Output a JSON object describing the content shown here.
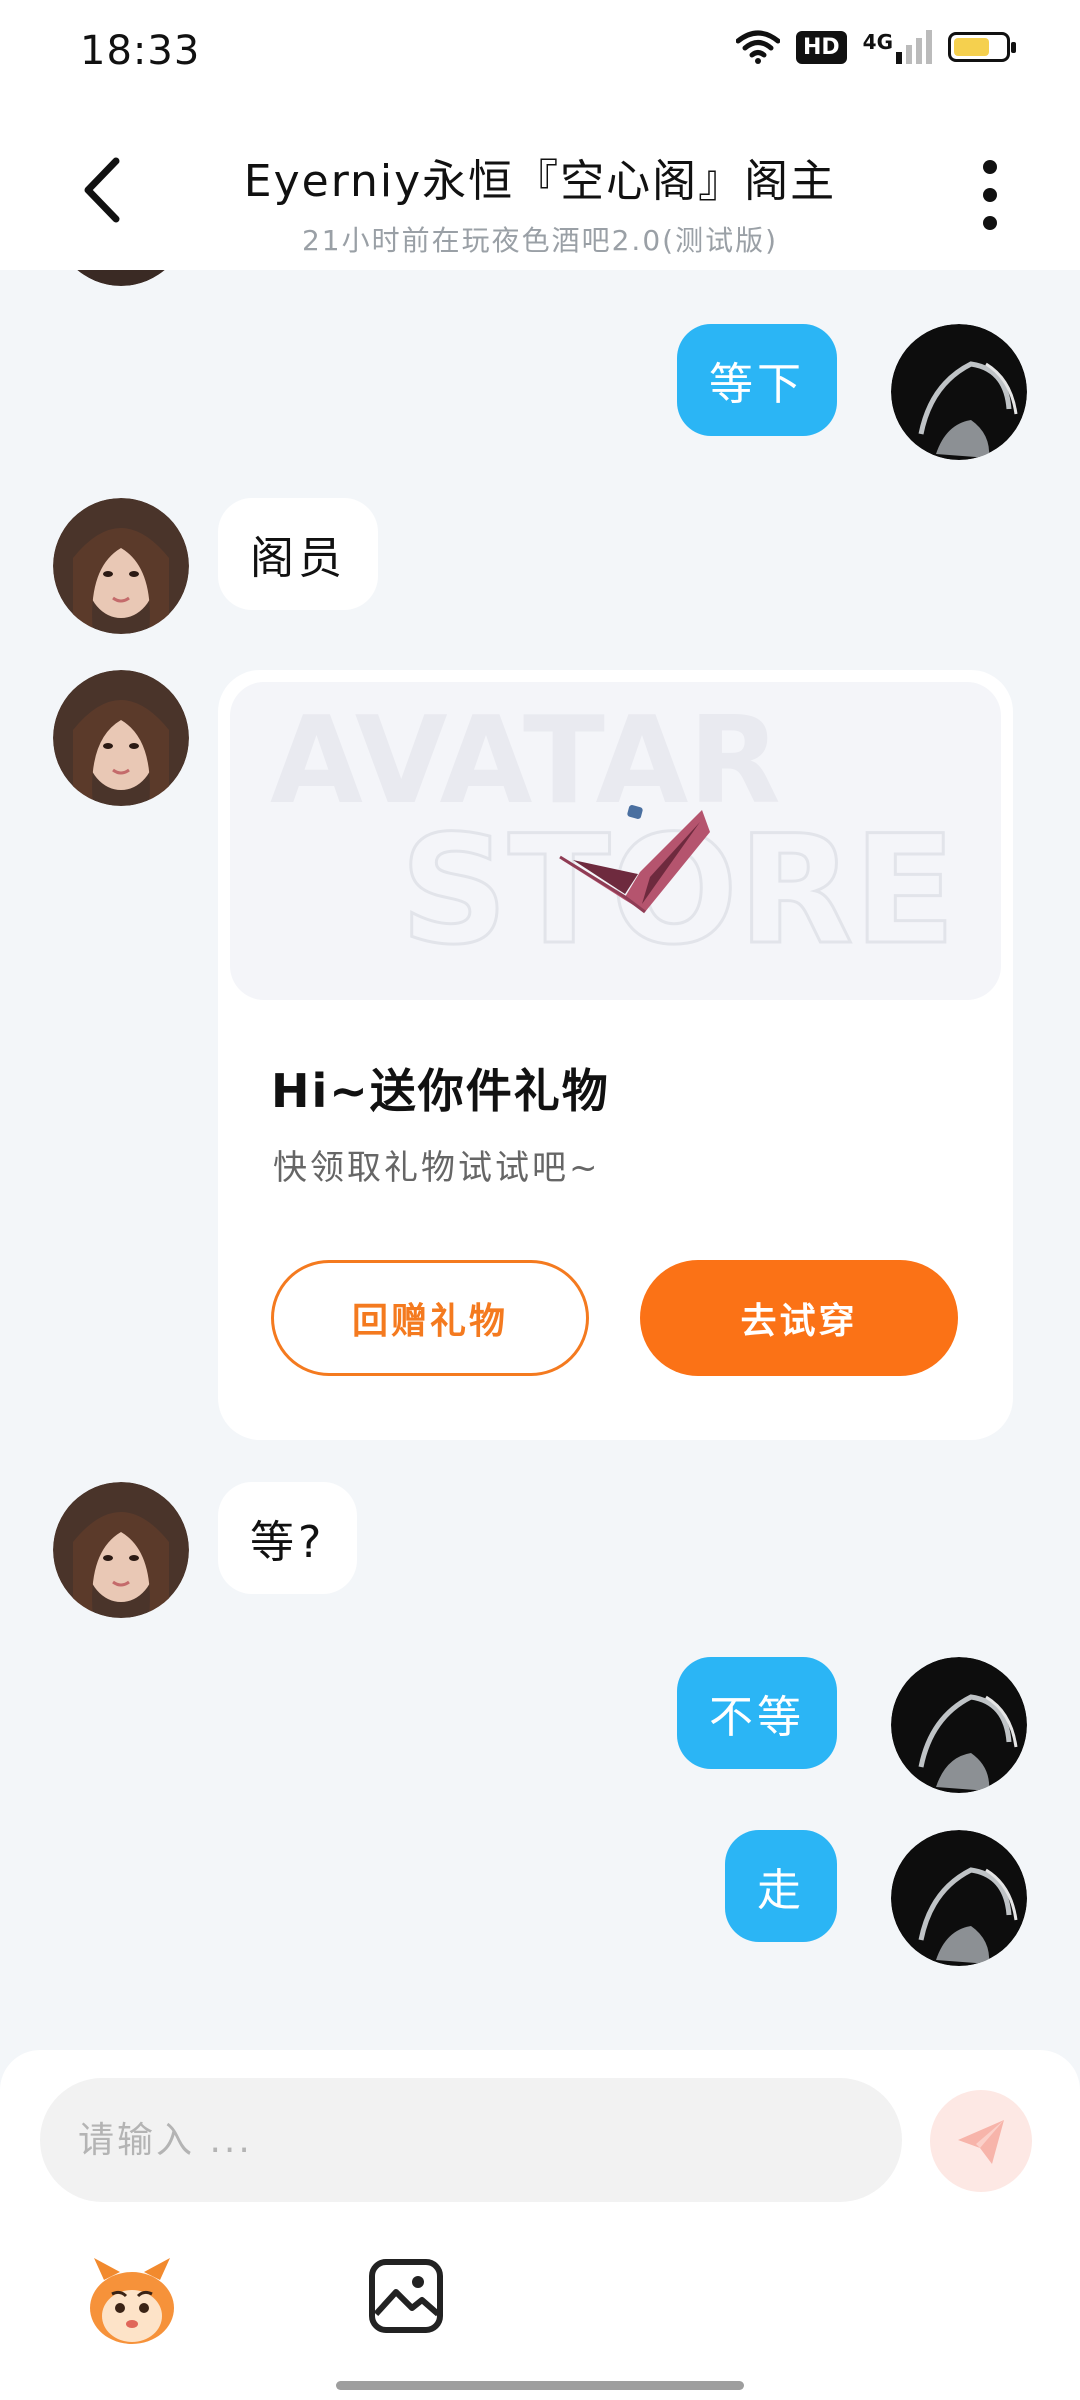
{
  "status_bar": {
    "time": "18:33",
    "hd_label": "HD",
    "network_label": "4G",
    "battery_level": 0.7,
    "battery_color": "#f5d04e"
  },
  "header": {
    "title": "Eyerniy永恒『空心阁』阁主",
    "subtitle": "21小时前在玩夜色酒吧2.0(测试版)",
    "back_icon": "chevron-left-icon",
    "more_icon": "vertical-dots-icon"
  },
  "messages": {
    "m1": "等下",
    "m2": "阁员",
    "m4": "等?",
    "m5": "不等",
    "m6": "走"
  },
  "gift_card": {
    "watermark_top": "AVATAR",
    "watermark_bottom": "STORE",
    "title": "Hi~送你件礼物",
    "description": "快领取礼物试试吧~",
    "return_gift_label": "回赠礼物",
    "try_on_label": "去试穿"
  },
  "input": {
    "placeholder": "请输入 ...",
    "value": ""
  },
  "colors": {
    "outgoing_bubble": "#2bb5f5",
    "incoming_bubble": "#ffffff",
    "accent_orange": "#fb7216",
    "chat_background": "#f3f6f9"
  },
  "icons": {
    "send": "paper-plane-icon",
    "emoji": "mascot-emoji-icon",
    "image": "image-icon"
  }
}
